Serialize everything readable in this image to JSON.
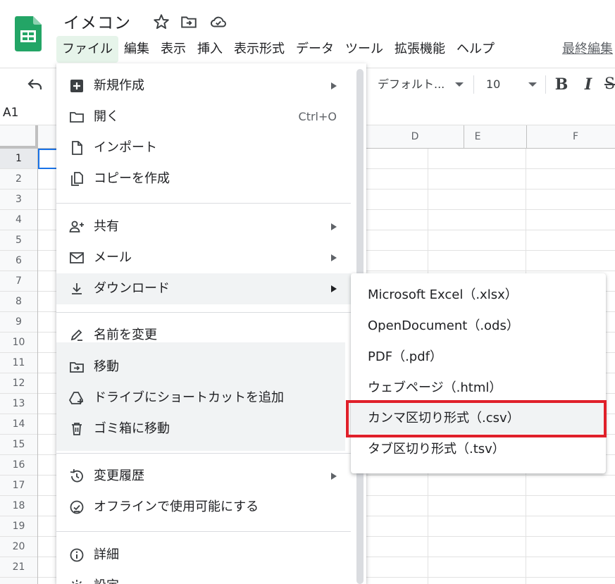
{
  "doc": {
    "title": "イメコン"
  },
  "menubar": {
    "items": [
      "ファイル",
      "編集",
      "表示",
      "挿入",
      "表示形式",
      "データ",
      "ツール",
      "拡張機能",
      "ヘルプ"
    ],
    "active_index": 0,
    "last_edit": "最終編集"
  },
  "toolbar": {
    "font": "デフォルト...",
    "font_size": "10",
    "bold": "B",
    "italic": "I",
    "strike": "S"
  },
  "namebox": "A1",
  "columns": [
    "D",
    "E",
    "F"
  ],
  "rows": [
    "1",
    "2",
    "3",
    "4",
    "5",
    "6",
    "7",
    "8",
    "9",
    "10",
    "11",
    "12",
    "13",
    "14",
    "15",
    "16",
    "17",
    "18",
    "19",
    "20",
    "21"
  ],
  "file_menu": {
    "items": [
      {
        "label": "新規作成",
        "icon": "new-sheet-icon",
        "submenu": true
      },
      {
        "label": "開く",
        "icon": "folder-icon",
        "shortcut": "Ctrl+O"
      },
      {
        "label": "インポート",
        "icon": "file-icon"
      },
      {
        "label": "コピーを作成",
        "icon": "copy-icon"
      },
      {
        "label": "共有",
        "icon": "person-add-icon",
        "submenu": true
      },
      {
        "label": "メール",
        "icon": "mail-icon",
        "submenu": true
      },
      {
        "label": "ダウンロード",
        "icon": "download-icon",
        "submenu": true,
        "hover": true
      },
      {
        "label": "名前を変更",
        "icon": "rename-icon"
      },
      {
        "label": "移動",
        "icon": "move-folder-icon"
      },
      {
        "label": "ドライブにショートカットを追加",
        "icon": "drive-shortcut-icon"
      },
      {
        "label": "ゴミ箱に移動",
        "icon": "trash-icon"
      },
      {
        "label": "変更履歴",
        "icon": "history-icon",
        "submenu": true
      },
      {
        "label": "オフラインで使用可能にする",
        "icon": "offline-icon"
      },
      {
        "label": "詳細",
        "icon": "info-icon"
      },
      {
        "label": "設定",
        "icon": "settings-icon"
      }
    ]
  },
  "download_menu": {
    "items": [
      "Microsoft Excel（.xlsx）",
      "OpenDocument（.ods）",
      "PDF（.pdf）",
      "ウェブページ（.html）",
      "カンマ区切り形式（.csv）",
      "タブ区切り形式（.tsv）"
    ],
    "highlighted_index": 4,
    "highlight_color": "#e0202a"
  }
}
